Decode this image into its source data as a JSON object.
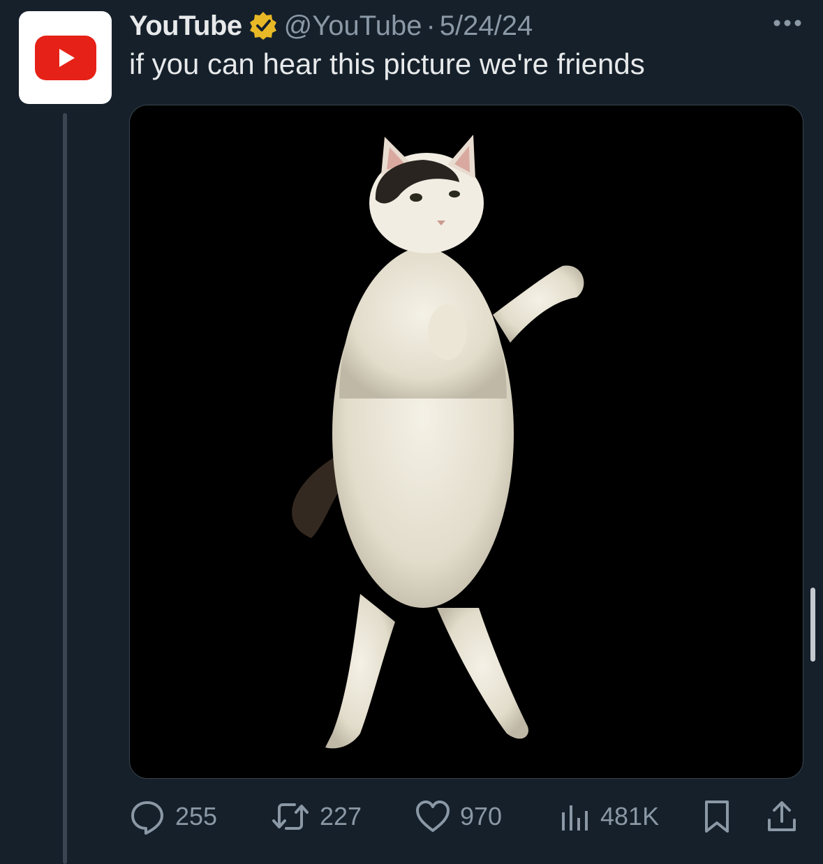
{
  "tweet": {
    "display_name": "YouTube",
    "handle": "@YouTube",
    "separator": "·",
    "date": "5/24/24",
    "text": "if you can hear this picture we're friends",
    "media_icon": "cat-photo",
    "verified_icon": "verified-badge-icon",
    "avatar_icon": "youtube-logo-icon"
  },
  "actions": {
    "replies": "255",
    "retweets": "227",
    "likes": "970",
    "views": "481K"
  },
  "colors": {
    "background": "#15202b",
    "primary_text": "#e7e9ea",
    "secondary_text": "#8b98a5",
    "youtube_red": "#e62117",
    "verified_gold": "#e8b826"
  }
}
